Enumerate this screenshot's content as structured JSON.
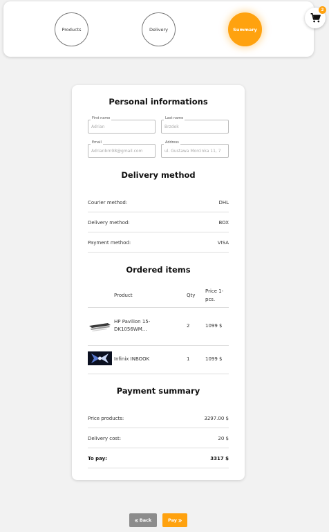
{
  "steps": [
    "Products",
    "Delivery",
    "Summary"
  ],
  "active_step": "Summary",
  "cart": {
    "count": "2"
  },
  "personal": {
    "title": "Personal informations",
    "first_name": {
      "label": "First name",
      "value": "Adrian"
    },
    "last_name": {
      "label": "Last name",
      "value": "Brzdek"
    },
    "email": {
      "label": "Email",
      "value": "Adrianbrn98@gmail.com"
    },
    "address": {
      "label": "Address",
      "value": "ul. Gustawa Morcinka 11, 7"
    }
  },
  "delivery": {
    "title": "Delivery method",
    "rows": [
      {
        "label": "Courier method:",
        "value": "DHL"
      },
      {
        "label": "Delivery method:",
        "value": "BOX"
      },
      {
        "label": "Payment method:",
        "value": "VISA"
      }
    ]
  },
  "items": {
    "title": "Ordered items",
    "headers": {
      "product": "Product",
      "qty": "Qty",
      "price": "Price 1-pcs."
    },
    "rows": [
      {
        "name": "HP Pavilion 15-DK1056WM...",
        "qty": "2",
        "price": "1099 $",
        "thumb": "laptop-silver"
      },
      {
        "name": "Infinix INBOOK",
        "qty": "1",
        "price": "1099 $",
        "thumb": "laptop-dark"
      }
    ]
  },
  "payment": {
    "title": "Payment summary",
    "rows": [
      {
        "label": "Price products:",
        "value": "3297.00 $"
      },
      {
        "label": "Delivery cost:",
        "value": "20 $"
      },
      {
        "label": "To pay:",
        "value": "3317 $"
      }
    ]
  },
  "actions": {
    "back": "Back",
    "pay": "Pay"
  },
  "colors": {
    "accent": "#ffa20f",
    "back_button": "#8c8c8c",
    "page_bg": "#f2f2f2"
  }
}
